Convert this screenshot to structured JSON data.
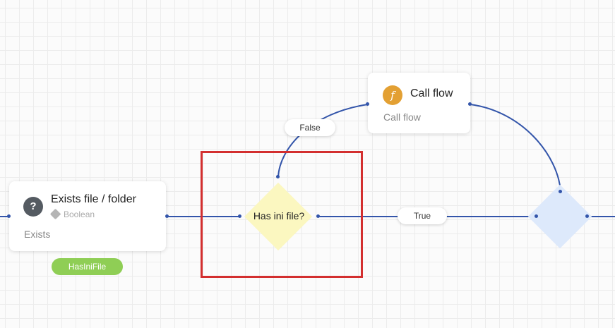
{
  "nodes": {
    "exists": {
      "title": "Exists file / folder",
      "type_tag": "Boolean",
      "subtitle": "Exists",
      "icon": "question-diamond-icon",
      "icon_glyph": "?",
      "icon_color": "#555b62",
      "output_variable": "HasIniFile"
    },
    "decision": {
      "label": "Has ini file?",
      "fill_color": "#fbf7c0"
    },
    "call_flow": {
      "title": "Call flow",
      "subtitle": "Call flow",
      "icon": "function-icon",
      "icon_glyph": "f",
      "icon_color": "#e3a033"
    },
    "merge": {
      "label": "",
      "fill_color": "#dde9fb"
    }
  },
  "edges": {
    "false_label": "False",
    "true_label": "True",
    "wire_color": "#3355aa"
  },
  "selection": {
    "color": "#d32f2f"
  }
}
